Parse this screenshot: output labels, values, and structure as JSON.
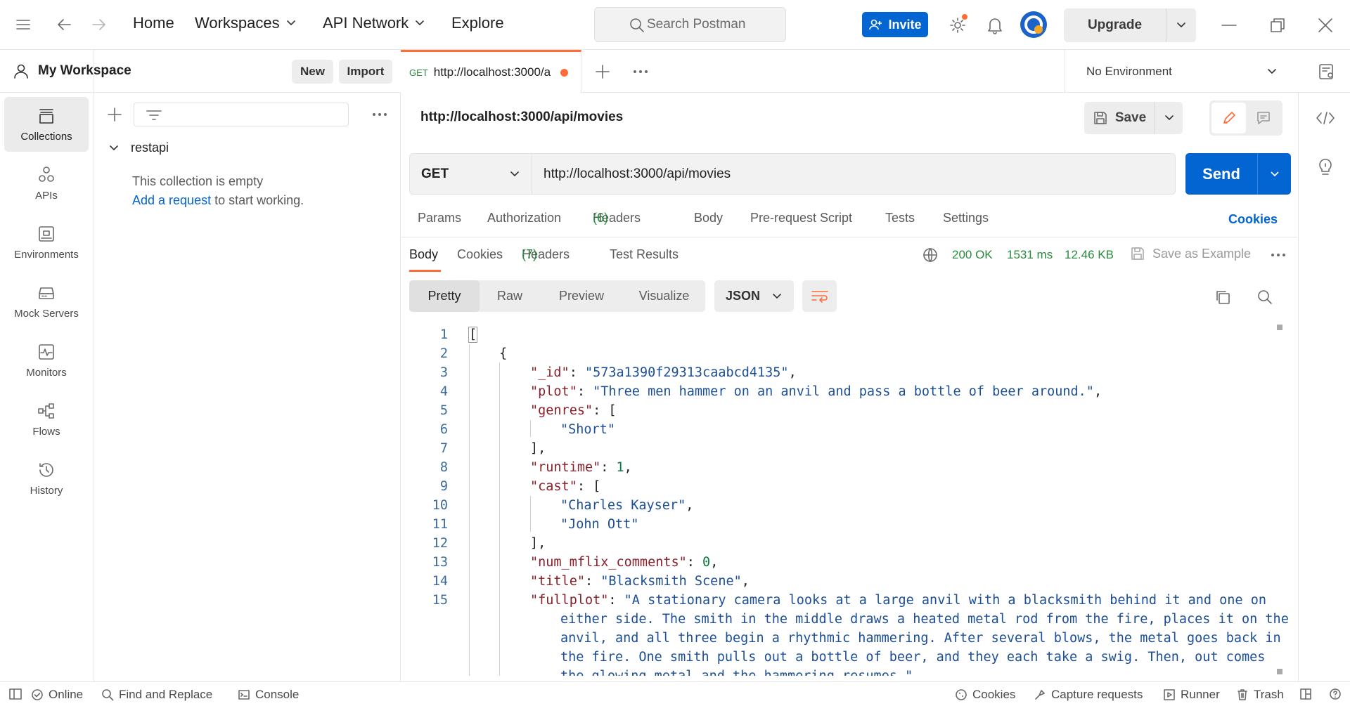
{
  "topbar": {
    "nav": [
      "Home",
      "Workspaces",
      "API Network",
      "Explore"
    ],
    "search_placeholder": "Search Postman",
    "invite_label": "Invite",
    "upgrade_label": "Upgrade"
  },
  "workspace": {
    "title": "My Workspace",
    "new_label": "New",
    "import_label": "Import"
  },
  "leftnav": [
    {
      "label": "Collections",
      "icon": "collections-icon",
      "active": true
    },
    {
      "label": "APIs",
      "icon": "apis-icon"
    },
    {
      "label": "Environments",
      "icon": "environments-icon"
    },
    {
      "label": "Mock Servers",
      "icon": "mock-servers-icon"
    },
    {
      "label": "Monitors",
      "icon": "monitors-icon"
    },
    {
      "label": "Flows",
      "icon": "flows-icon"
    },
    {
      "label": "History",
      "icon": "history-icon"
    }
  ],
  "collections": {
    "name": "restapi",
    "empty_text": "This collection is empty",
    "add_link": "Add a request",
    "add_suffix": " to start working."
  },
  "tab": {
    "method": "GET",
    "title": "http://localhost:3000/a"
  },
  "environment": "No Environment",
  "request": {
    "title": "http://localhost:3000/api/movies",
    "save_label": "Save",
    "method": "GET",
    "url": "http://localhost:3000/api/movies",
    "send_label": "Send",
    "tabs": {
      "params": "Params",
      "authorization": "Authorization",
      "headers": "Headers",
      "headers_count": "(6)",
      "body": "Body",
      "prerequest": "Pre-request Script",
      "tests": "Tests",
      "settings": "Settings"
    },
    "cookies_label": "Cookies"
  },
  "response": {
    "tabs": {
      "body": "Body",
      "cookies": "Cookies",
      "headers": "Headers",
      "headers_count": "(7)",
      "test_results": "Test Results"
    },
    "status": "200 OK",
    "time": "1531 ms",
    "size": "12.46 KB",
    "save_example": "Save as Example",
    "views": [
      "Pretty",
      "Raw",
      "Preview",
      "Visualize"
    ],
    "format": "JSON"
  },
  "code": {
    "l1": "[",
    "l2": "{",
    "l3_key": "\"_id\"",
    "l3_val": "\"573a1390f29313caabcd4135\"",
    "l4_key": "\"plot\"",
    "l4_val": "\"Three men hammer on an anvil and pass a bottle of beer around.\"",
    "l5_key": "\"genres\"",
    "l6_val": "\"Short\"",
    "l7": "],",
    "l8_key": "\"runtime\"",
    "l8_val": "1",
    "l9_key": "\"cast\"",
    "l10_val": "\"Charles Kayser\"",
    "l11_val": "\"John Ott\"",
    "l12": "],",
    "l13_key": "\"num_mflix_comments\"",
    "l13_val": "0",
    "l14_key": "\"title\"",
    "l14_val": "\"Blacksmith Scene\"",
    "l15_key": "\"fullplot\"",
    "l15_a": "\"A stationary camera looks at a large anvil with a blacksmith behind it and one on",
    "l15_b": "either side. The smith in the middle draws a heated metal rod from the fire, places it on the",
    "l15_c": "anvil, and all three begin a rhythmic hammering. After several blows, the metal goes back in",
    "l15_d": "the fire. One smith pulls out a bottle of beer, and they each take a swig. Then, out comes",
    "l15_e": "the glowing metal and the hammering resumes.\","
  },
  "line_numbers": [
    "1",
    "2",
    "3",
    "4",
    "5",
    "6",
    "7",
    "8",
    "9",
    "10",
    "11",
    "12",
    "13",
    "14",
    "15"
  ],
  "statusbar": {
    "online": "Online",
    "find_replace": "Find and Replace",
    "console": "Console",
    "cookies": "Cookies",
    "capture": "Capture requests",
    "runner": "Runner",
    "trash": "Trash"
  },
  "colors": {
    "accent": "#ff6c37",
    "primary": "#0265d2",
    "success": "#2a8a3e"
  }
}
